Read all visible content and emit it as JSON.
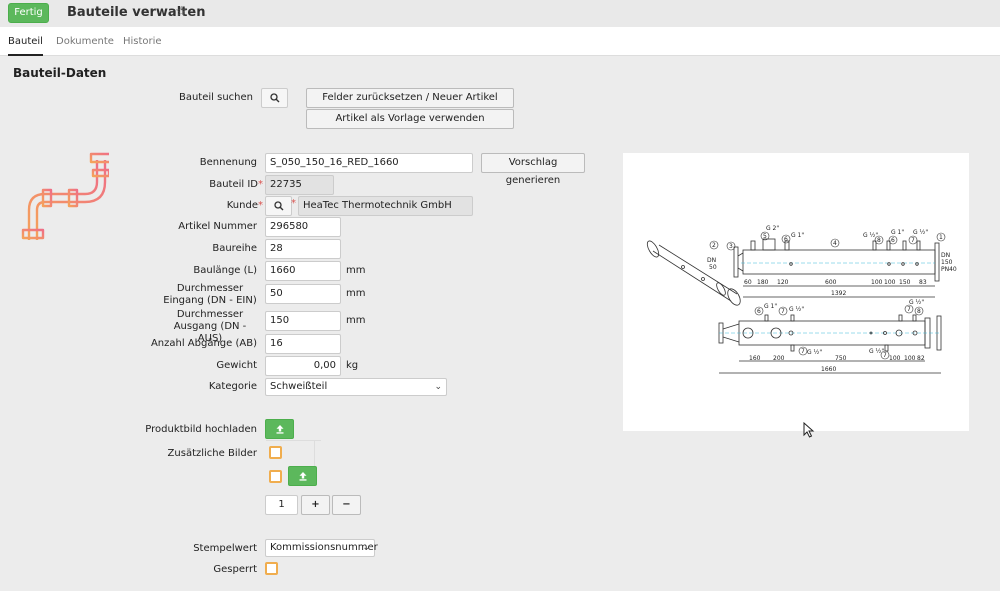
{
  "header": {
    "done_label": "Fertig",
    "title": "Bauteile verwalten"
  },
  "tabs": [
    {
      "label": "Bauteil",
      "active": true
    },
    {
      "label": "Dokumente",
      "active": false
    },
    {
      "label": "Historie",
      "active": false
    }
  ],
  "section": {
    "title": "Bauteil-Daten"
  },
  "search": {
    "label": "Bauteil suchen",
    "reset_button": "Felder zurücksetzen / Neuer Artikel",
    "template_button": "Artikel als Vorlage verwenden"
  },
  "fields": {
    "bennenung": {
      "label": "Bennenung",
      "value": "S_050_150_16_RED_1660"
    },
    "suggest_button": "Vorschlag generieren",
    "bauteil_id": {
      "label": "Bauteil ID",
      "required_mark": "*",
      "value": "22735"
    },
    "kunde": {
      "label": "Kunde",
      "required_mark": "*",
      "value": "HeaTec Thermotechnik GmbH"
    },
    "artikel_nummer": {
      "label": "Artikel Nummer",
      "value": "296580"
    },
    "baureihe": {
      "label": "Baureihe",
      "value": "28"
    },
    "baulaenge": {
      "label": "Baulänge (L)",
      "value": "1660",
      "unit": "mm"
    },
    "dn_ein": {
      "label": "Durchmesser Eingang (DN - EIN)",
      "value": "50",
      "unit": "mm"
    },
    "dn_aus": {
      "label": "Durchmesser Ausgang (DN - AUS)",
      "value": "150",
      "unit": "mm"
    },
    "abgaenge": {
      "label": "Anzahl Abgänge (AB)",
      "value": "16"
    },
    "gewicht": {
      "label": "Gewicht",
      "value": "0,00",
      "unit": "kg"
    },
    "kategorie": {
      "label": "Kategorie",
      "value": "Schweißteil"
    },
    "produktbild": {
      "label": "Produktbild hochladen"
    },
    "zusaetzliche_bilder": {
      "label": "Zusätzliche Bilder"
    },
    "counter": {
      "value": "1",
      "plus": "+",
      "minus": "−"
    },
    "stempelwert": {
      "label": "Stempelwert",
      "value": "Kommissionsnummer"
    },
    "gesperrt": {
      "label": "Gesperrt"
    }
  },
  "drawing": {
    "top_labels": [
      "G 2\"",
      "G 1\"",
      "G ½\"",
      "G 1\"",
      "G ½\""
    ],
    "dn_in": "DN 50",
    "dn_out": "DN 150",
    "pn": "PN40",
    "dims_top": [
      "60",
      "180",
      "120",
      "600",
      "100",
      "100",
      "150",
      "83"
    ],
    "total_top": "1392",
    "bottom_labels": [
      "G 1\"",
      "G ½\"",
      "G ½\"",
      "G ½\"",
      "G ½\""
    ],
    "dims_bottom": [
      "160",
      "200",
      "750",
      "100",
      "100",
      "82"
    ],
    "total_bottom": "1660",
    "numbers": [
      "1",
      "2",
      "3",
      "4",
      "5",
      "6",
      "7",
      "8"
    ]
  },
  "colors": {
    "accent_green": "#5cb85c",
    "checkbox_orange": "#f0ad4e"
  }
}
